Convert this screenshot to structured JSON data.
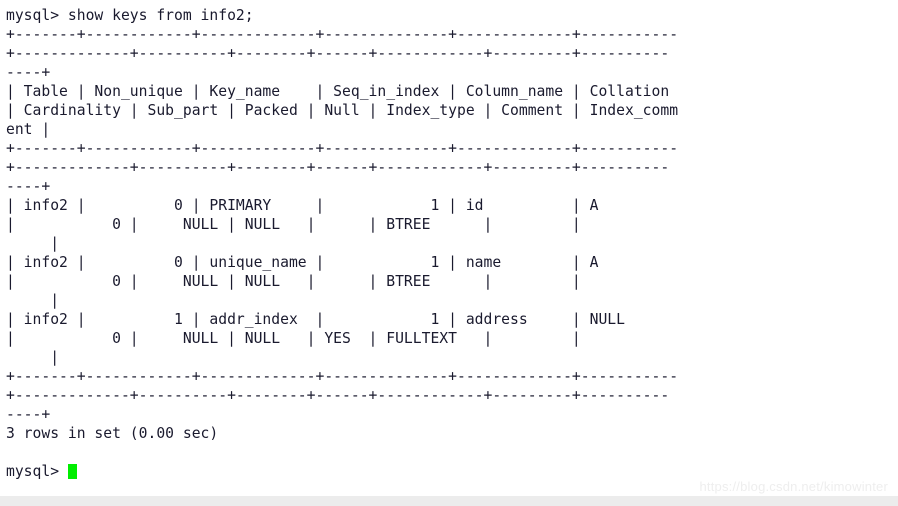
{
  "terminal": {
    "query_line": "mysql> show keys from info2;",
    "separator_top_1": "+-------+------------+-------------+--------------+-------------+-----------",
    "separator_top_2": "+-------------+----------+--------+------+------------+---------+----------",
    "separator_top_wrap": "----+",
    "header_line_1": "| Table | Non_unique | Key_name    | Seq_in_index | Column_name | Collation",
    "header_line_2": "| Cardinality | Sub_part | Packed | Null | Index_type | Comment | Index_comm",
    "header_line_wrap": "ent |",
    "separator_mid_1": "+-------+------------+-------------+--------------+-------------+-----------",
    "separator_mid_2": "+-------------+----------+--------+------+------------+---------+----------",
    "separator_mid_wrap": "----+",
    "row1_line_1": "| info2 |          0 | PRIMARY     |            1 | id          | A",
    "row1_line_2": "|           0 |     NULL | NULL   |      | BTREE      |         |",
    "row1_line_wrap": "     |",
    "row2_line_1": "| info2 |          0 | unique_name |            1 | name        | A",
    "row2_line_2": "|           0 |     NULL | NULL   |      | BTREE      |         |",
    "row2_line_wrap": "     |",
    "row3_line_1": "| info2 |          1 | addr_index  |            1 | address     | NULL",
    "row3_line_2": "|           0 |     NULL | NULL   | YES  | FULLTEXT   |         |",
    "row3_line_wrap": "     |",
    "separator_bottom_1": "+-------+------------+-------------+--------------+-------------+-----------",
    "separator_bottom_2": "+-------------+----------+--------+------+------------+---------+----------",
    "separator_bottom_wrap": "----+",
    "result_line": "3 rows in set (0.00 sec)",
    "prompt": "mysql> ",
    "cursor_color": "#00ee00",
    "text_color": "#1a1a2e",
    "background_color": "#ffffff"
  },
  "watermark": {
    "text": "https://blog.csdn.net/kimowinter"
  },
  "result_table": {
    "columns": [
      "Table",
      "Non_unique",
      "Key_name",
      "Seq_in_index",
      "Column_name",
      "Collation",
      "Cardinality",
      "Sub_part",
      "Packed",
      "Null",
      "Index_type",
      "Comment",
      "Index_comment"
    ],
    "rows": [
      {
        "Table": "info2",
        "Non_unique": "0",
        "Key_name": "PRIMARY",
        "Seq_in_index": "1",
        "Column_name": "id",
        "Collation": "A",
        "Cardinality": "0",
        "Sub_part": "NULL",
        "Packed": "NULL",
        "Null": "",
        "Index_type": "BTREE",
        "Comment": "",
        "Index_comment": ""
      },
      {
        "Table": "info2",
        "Non_unique": "0",
        "Key_name": "unique_name",
        "Seq_in_index": "1",
        "Column_name": "name",
        "Collation": "A",
        "Cardinality": "0",
        "Sub_part": "NULL",
        "Packed": "NULL",
        "Null": "",
        "Index_type": "BTREE",
        "Comment": "",
        "Index_comment": ""
      },
      {
        "Table": "info2",
        "Non_unique": "1",
        "Key_name": "addr_index",
        "Seq_in_index": "1",
        "Column_name": "address",
        "Collation": "NULL",
        "Cardinality": "0",
        "Sub_part": "NULL",
        "Packed": "NULL",
        "Null": "YES",
        "Index_type": "FULLTEXT",
        "Comment": "",
        "Index_comment": ""
      }
    ],
    "row_count_text": "3 rows in set (0.00 sec)"
  }
}
